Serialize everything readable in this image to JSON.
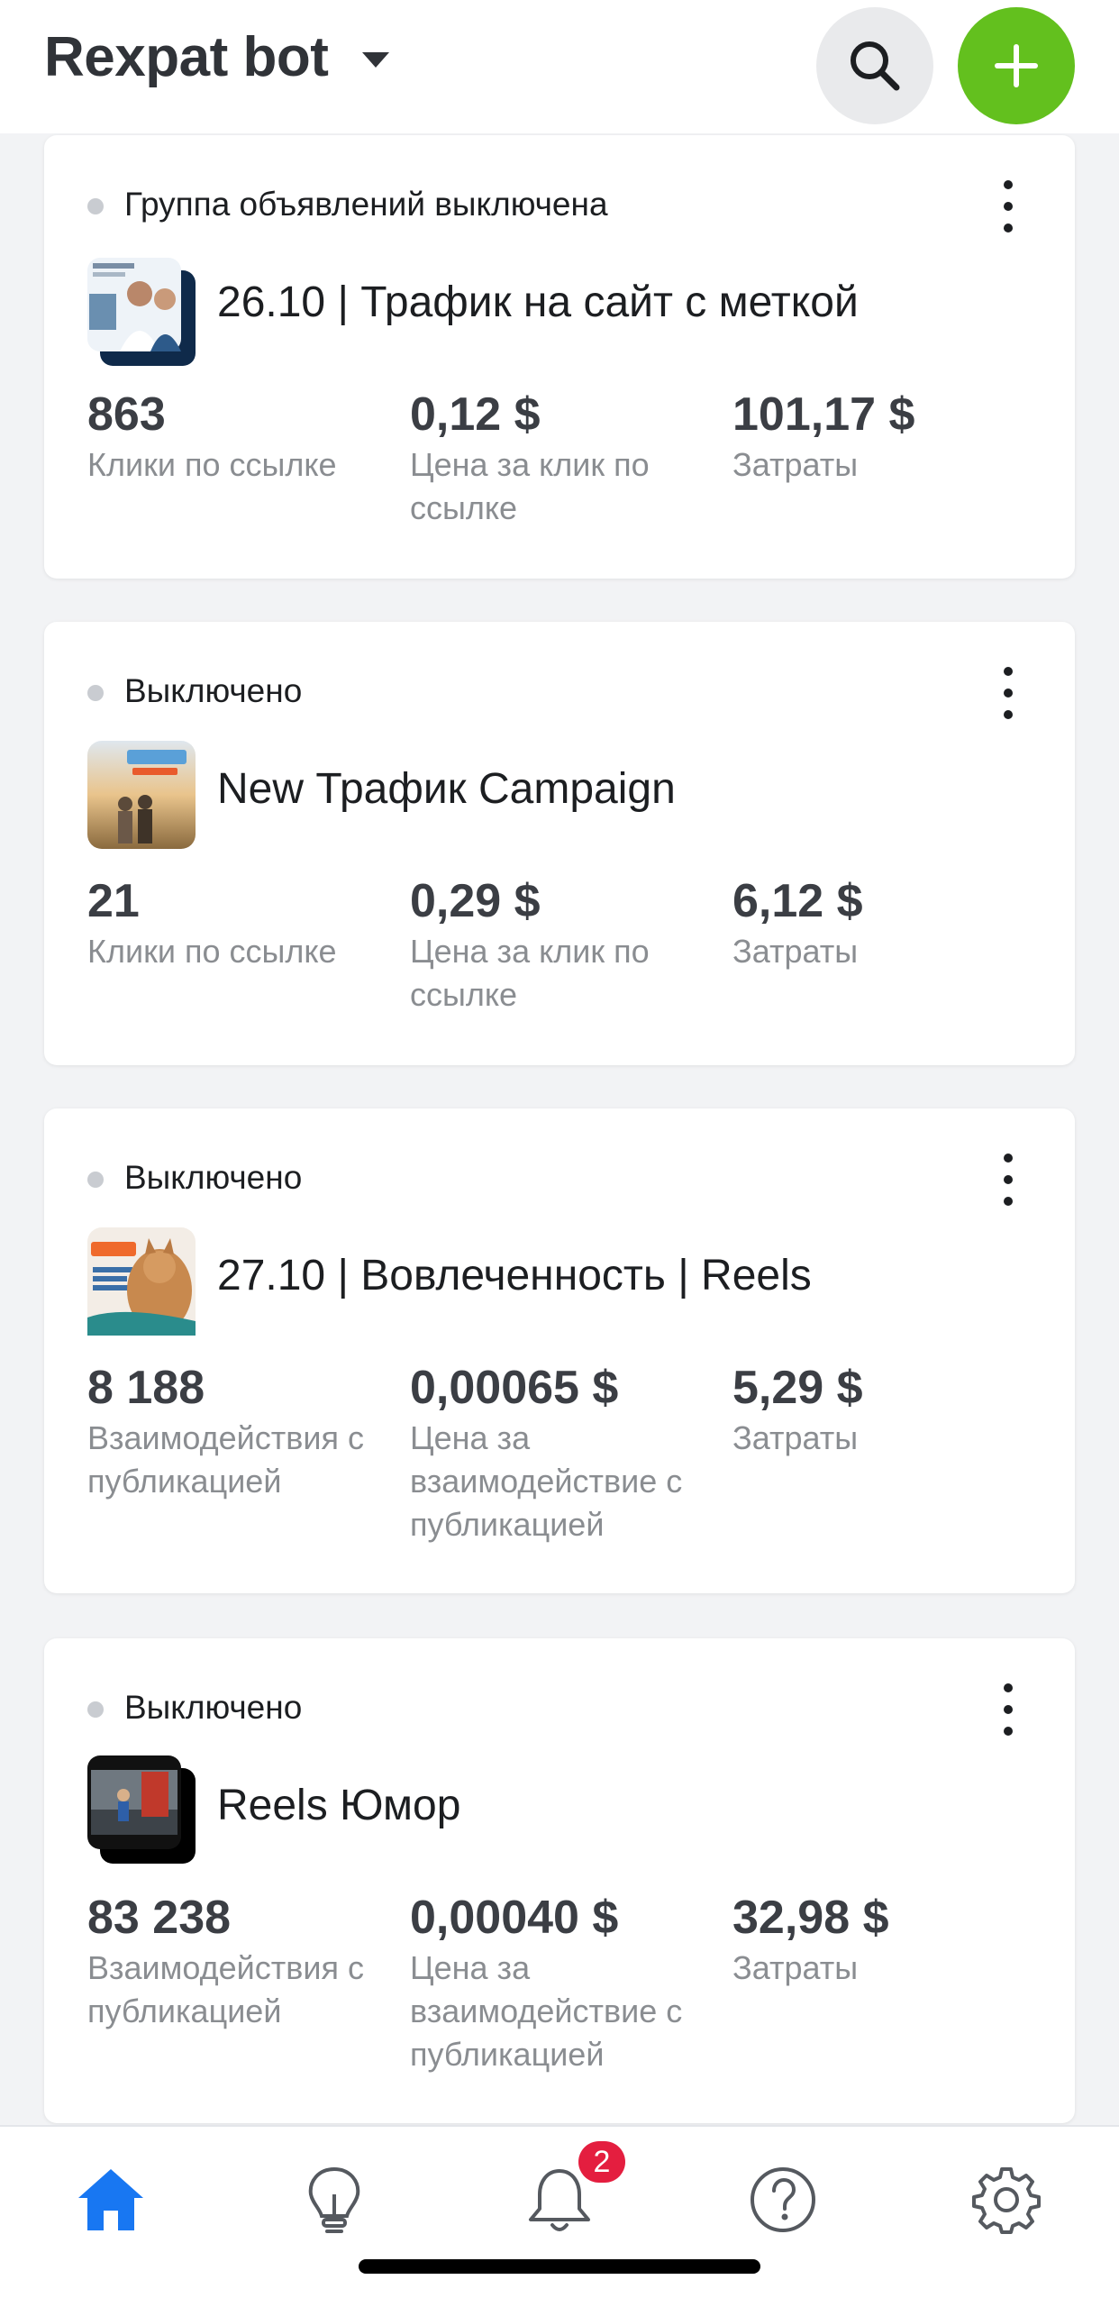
{
  "header": {
    "title": "Rexpat bot"
  },
  "colors": {
    "accent_green": "#63c01e",
    "active_nav_blue": "#1877f2",
    "badge_red": "#e41e3f",
    "status_dot_gray": "#c9ccd1"
  },
  "icons": {
    "search": "search-icon",
    "add": "plus-icon",
    "more": "more-vertical-icon",
    "nav": [
      "home-icon",
      "lightbulb-icon",
      "bell-icon",
      "help-icon",
      "gear-icon"
    ]
  },
  "campaigns": [
    {
      "status": "Группа объявлений выключена",
      "name": "26.10 | Трафик на сайт с меткой",
      "metrics": [
        {
          "value": "863",
          "label": "Клики по ссылке"
        },
        {
          "value": "0,12 $",
          "label": "Цена за клик по ссылке"
        },
        {
          "value": "101,17 $",
          "label": "Затраты"
        }
      ]
    },
    {
      "status": "Выключено",
      "name": "New Трафик Campaign",
      "metrics": [
        {
          "value": "21",
          "label": "Клики по ссылке"
        },
        {
          "value": "0,29 $",
          "label": "Цена за клик по ссылке"
        },
        {
          "value": "6,12 $",
          "label": "Затраты"
        }
      ]
    },
    {
      "status": "Выключено",
      "name": "27.10 | Вовлеченность | Reels",
      "metrics": [
        {
          "value": "8 188",
          "label": "Взаимодействия с публикацией"
        },
        {
          "value": "0,00065 $",
          "label": "Цена за взаимодействие с публикацией"
        },
        {
          "value": "5,29 $",
          "label": "Затраты"
        }
      ]
    },
    {
      "status": "Выключено",
      "name": "Reels Юмор",
      "metrics": [
        {
          "value": "83 238",
          "label": "Взаимодействия с публикацией"
        },
        {
          "value": "0,00040 $",
          "label": "Цена за взаимодействие с публикацией"
        },
        {
          "value": "32,98 $",
          "label": "Затраты"
        }
      ]
    }
  ],
  "bottom_nav": {
    "notification_count": "2"
  }
}
